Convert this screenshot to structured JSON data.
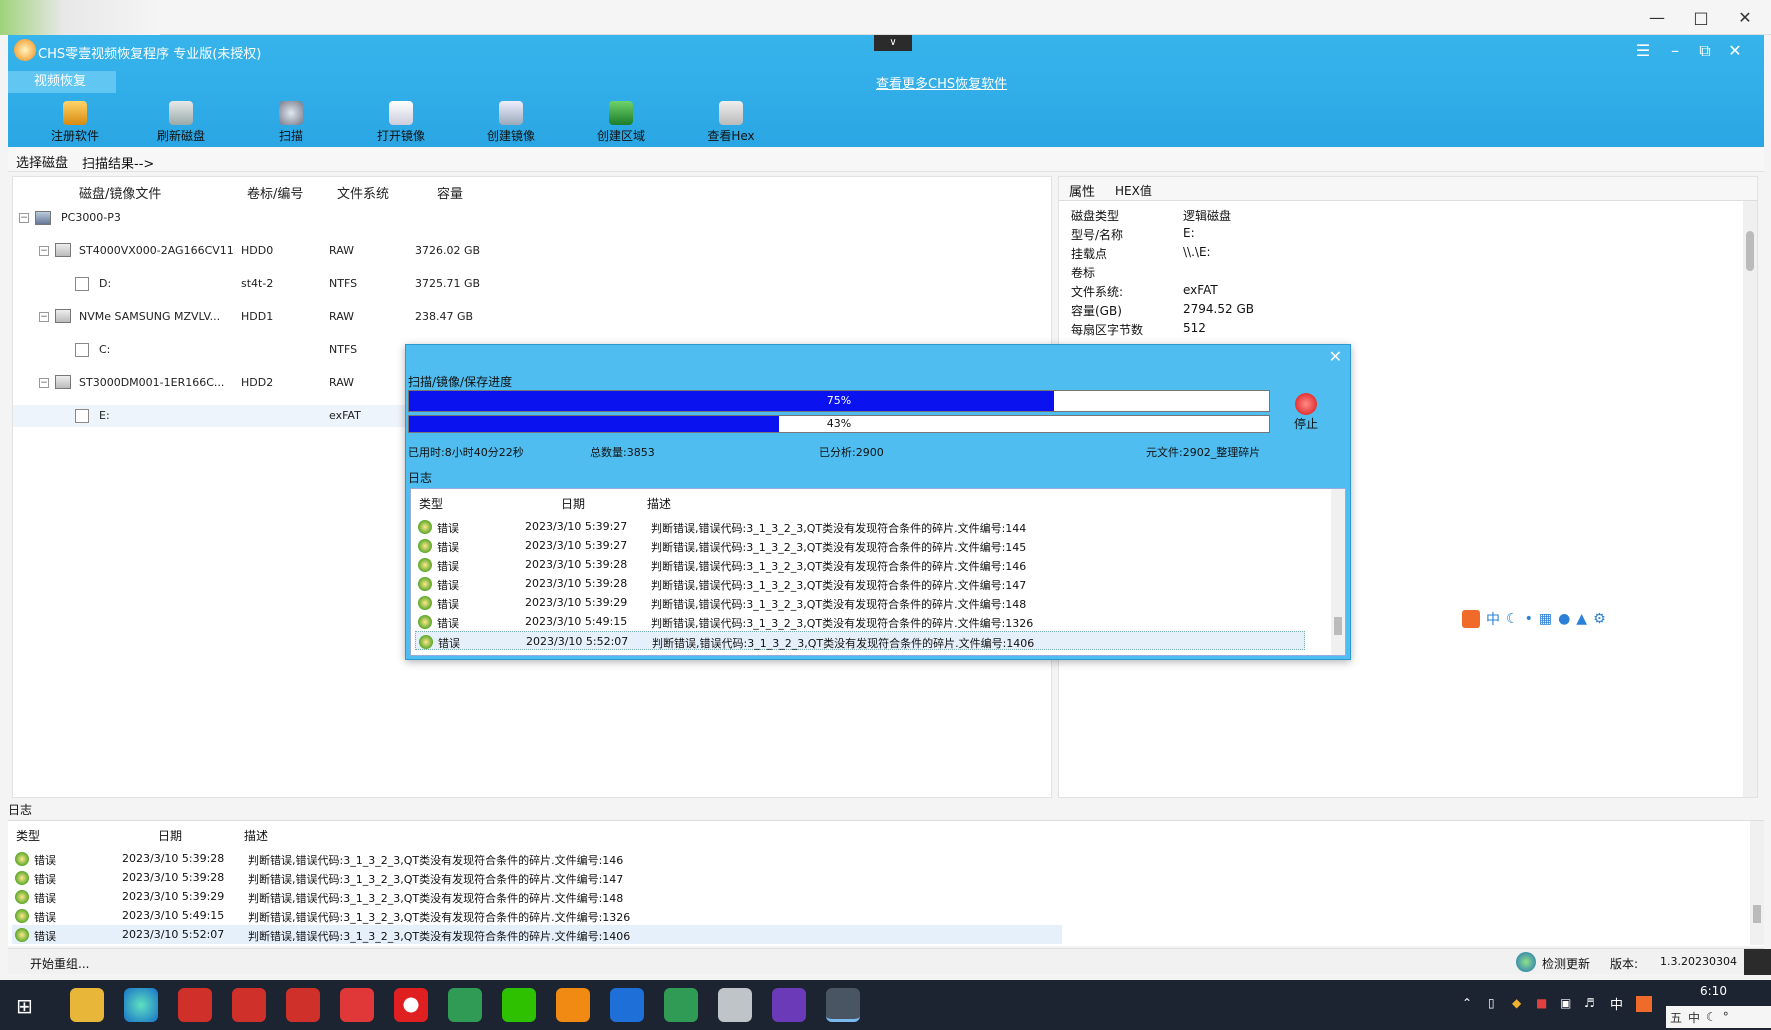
{
  "app": {
    "title": "CHS零壹视频恢复程序 专业版(未授权)",
    "tab_video": "视频恢复",
    "more_link": "查看更多CHS恢复软件"
  },
  "toolbar": [
    {
      "label": "注册软件",
      "icon": "key-icon"
    },
    {
      "label": "刷新磁盘",
      "icon": "refresh-disk-icon"
    },
    {
      "label": "扫描",
      "icon": "magnifier-icon"
    },
    {
      "label": "打开镜像",
      "icon": "open-image-icon"
    },
    {
      "label": "创建镜像",
      "icon": "create-image-icon"
    },
    {
      "label": "创建区域",
      "icon": "create-region-icon"
    },
    {
      "label": "查看Hex",
      "icon": "hex-view-icon"
    }
  ],
  "breadcrumb": {
    "select_disk": "选择磁盘",
    "scan_result": "扫描结果-->"
  },
  "disk_table": {
    "headers": [
      "磁盘/镜像文件",
      "卷标/编号",
      "文件系统",
      "容量"
    ],
    "rows": [
      {
        "name": "PC3000-P3",
        "label": "",
        "fs": "",
        "cap": ""
      },
      {
        "name": "ST4000VX000-2AG166CV11",
        "label": "HDD0",
        "fs": "RAW",
        "cap": "3726.02 GB"
      },
      {
        "name": "D:",
        "label": "st4t-2",
        "fs": "NTFS",
        "cap": "3725.71 GB"
      },
      {
        "name": "NVMe    SAMSUNG MZVLV...",
        "label": "HDD1",
        "fs": "RAW",
        "cap": "238.47 GB"
      },
      {
        "name": "C:",
        "label": "",
        "fs": "NTFS",
        "cap": ""
      },
      {
        "name": "ST3000DM001-1ER166C...",
        "label": "HDD2",
        "fs": "RAW",
        "cap": ""
      },
      {
        "name": "E:",
        "label": "",
        "fs": "exFAT",
        "cap": ""
      }
    ]
  },
  "props": {
    "tabs": [
      "属性",
      "HEX值"
    ],
    "rows": [
      {
        "k": "磁盘类型",
        "v": "逻辑磁盘"
      },
      {
        "k": "型号/名称",
        "v": "E:"
      },
      {
        "k": "挂载点",
        "v": "\\\\.\\E:"
      },
      {
        "k": "卷标",
        "v": ""
      },
      {
        "k": "文件系统:",
        "v": "exFAT"
      },
      {
        "k": "容量(GB)",
        "v": "2794.52 GB"
      },
      {
        "k": "每扇区字节数",
        "v": "512"
      }
    ]
  },
  "dialog": {
    "title": "扫描/镜像/保存进度",
    "bar1": {
      "value": 0.75,
      "label": "75%"
    },
    "bar2": {
      "value": 0.43,
      "label": "43%"
    },
    "stop": "停止",
    "elapsed": "已用时:8小时40分22秒",
    "total": "总数量:3853",
    "analyzed": "已分析:2900",
    "meta": "元文件:2902_整理碎片",
    "log_title": "日志",
    "log_headers": [
      "类型",
      "日期",
      "描述"
    ],
    "log_rows": [
      {
        "type": "错误",
        "date": "2023/3/10 5:39:27",
        "desc": "判断错误,错误代码:3_1_3_2_3,QT类没有发现符合条件的碎片.文件编号:144"
      },
      {
        "type": "错误",
        "date": "2023/3/10 5:39:27",
        "desc": "判断错误,错误代码:3_1_3_2_3,QT类没有发现符合条件的碎片.文件编号:145"
      },
      {
        "type": "错误",
        "date": "2023/3/10 5:39:28",
        "desc": "判断错误,错误代码:3_1_3_2_3,QT类没有发现符合条件的碎片.文件编号:146"
      },
      {
        "type": "错误",
        "date": "2023/3/10 5:39:28",
        "desc": "判断错误,错误代码:3_1_3_2_3,QT类没有发现符合条件的碎片.文件编号:147"
      },
      {
        "type": "错误",
        "date": "2023/3/10 5:39:29",
        "desc": "判断错误,错误代码:3_1_3_2_3,QT类没有发现符合条件的碎片.文件编号:148"
      },
      {
        "type": "错误",
        "date": "2023/3/10 5:49:15",
        "desc": "判断错误,错误代码:3_1_3_2_3,QT类没有发现符合条件的碎片.文件编号:1326"
      },
      {
        "type": "错误",
        "date": "2023/3/10 5:52:07",
        "desc": "判断错误,错误代码:3_1_3_2_3,QT类没有发现符合条件的碎片.文件编号:1406"
      }
    ]
  },
  "bottom_log": {
    "title": "日志",
    "headers": [
      "类型",
      "日期",
      "描述"
    ],
    "rows": [
      {
        "type": "错误",
        "date": "2023/3/10 5:39:28",
        "desc": "判断错误,错误代码:3_1_3_2_3,QT类没有发现符合条件的碎片.文件编号:146"
      },
      {
        "type": "错误",
        "date": "2023/3/10 5:39:28",
        "desc": "判断错误,错误代码:3_1_3_2_3,QT类没有发现符合条件的碎片.文件编号:147"
      },
      {
        "type": "错误",
        "date": "2023/3/10 5:39:29",
        "desc": "判断错误,错误代码:3_1_3_2_3,QT类没有发现符合条件的碎片.文件编号:148"
      },
      {
        "type": "错误",
        "date": "2023/3/10 5:49:15",
        "desc": "判断错误,错误代码:3_1_3_2_3,QT类没有发现符合条件的碎片.文件编号:1326"
      },
      {
        "type": "错误",
        "date": "2023/3/10 5:52:07",
        "desc": "判断错误,错误代码:3_1_3_2_3,QT类没有发现符合条件的碎片.文件编号:1406"
      }
    ]
  },
  "status": {
    "left": "开始重组...",
    "check_update": "检测更新",
    "version_label": "版本:",
    "version": "1.3.20230304"
  },
  "ime_bar": [
    "中"
  ],
  "taskbar": {
    "time": "6:10",
    "ime": "中",
    "tray_ime": [
      "五",
      "中"
    ]
  },
  "colors": {
    "accent": "#2aa6e4",
    "progress": "#0a12f0",
    "dialog": "#4fbdf0"
  }
}
